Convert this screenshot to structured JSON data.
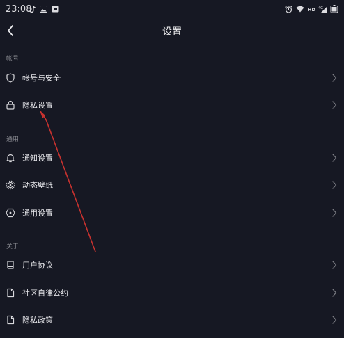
{
  "status_bar": {
    "time": "23:08",
    "left_icons": [
      "tiktok-icon",
      "image-icon",
      "app-icon"
    ],
    "right_icons": [
      "alarm-icon",
      "wifi-icon",
      "hd-icon",
      "signal-4g-icon",
      "battery-icon"
    ]
  },
  "header": {
    "title": "设置",
    "back_icon": "chevron-left-icon"
  },
  "sections": [
    {
      "label": "帐号",
      "items": [
        {
          "label": "帐号与安全",
          "icon": "shield-icon"
        },
        {
          "label": "隐私设置",
          "icon": "lock-icon"
        }
      ]
    },
    {
      "label": "通用",
      "items": [
        {
          "label": "通知设置",
          "icon": "bell-icon"
        },
        {
          "label": "动态壁纸",
          "icon": "wallpaper-icon"
        },
        {
          "label": "通用设置",
          "icon": "hexagon-icon"
        }
      ]
    },
    {
      "label": "关于",
      "items": [
        {
          "label": "用户协议",
          "icon": "book-icon"
        },
        {
          "label": "社区自律公约",
          "icon": "document-icon"
        },
        {
          "label": "隐私政策",
          "icon": "document-icon"
        }
      ]
    }
  ],
  "chevron_icon": "chevron-right-icon",
  "colors": {
    "background": "#161823",
    "text": "#e6e6ea",
    "section_label": "#8a8b92",
    "chevron": "#7d7e85",
    "annotation_line": "#c8322f"
  }
}
